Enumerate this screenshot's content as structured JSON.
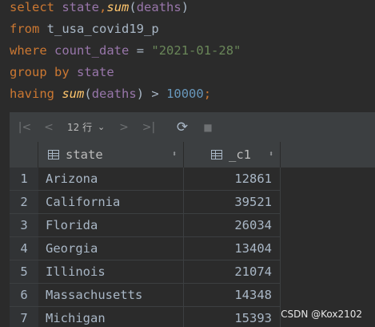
{
  "editor": {
    "line1": {
      "select": "select",
      "col1": "state",
      "comma": ",",
      "fn": "sum",
      "open": "(",
      "col2": "deaths",
      "close": ")"
    },
    "line2": {
      "from": "from",
      "table": "t_usa_covid19_p"
    },
    "line3": {
      "where": "where",
      "col": "count_date",
      "eq": "=",
      "value": "\"2021-01-28\""
    },
    "line4": {
      "group": "group",
      "by": "by",
      "col": "state"
    },
    "line5": {
      "having": "having",
      "fn": "sum",
      "open": "(",
      "col": "deaths",
      "close": ")",
      "gt": ">",
      "value": "10000",
      "semi": ";"
    }
  },
  "toolbar": {
    "first_icon": "|<",
    "prev_icon": "<",
    "row_count": "12 行",
    "dropdown_icon": "⌄",
    "next_icon": ">",
    "last_icon": ">|",
    "refresh_icon": "⟳",
    "stop_icon": "■"
  },
  "grid": {
    "columns": [
      {
        "label": "state",
        "sort_icon": "⬍"
      },
      {
        "label": "_c1",
        "sort_icon": "⬍"
      }
    ],
    "rows": [
      {
        "num": "1",
        "state": "Arizona",
        "c1": "12861"
      },
      {
        "num": "2",
        "state": "California",
        "c1": "39521"
      },
      {
        "num": "3",
        "state": "Florida",
        "c1": "26034"
      },
      {
        "num": "4",
        "state": "Georgia",
        "c1": "13404"
      },
      {
        "num": "5",
        "state": "Illinois",
        "c1": "21074"
      },
      {
        "num": "6",
        "state": "Massachusetts",
        "c1": "14348"
      },
      {
        "num": "7",
        "state": "Michigan",
        "c1": "15393"
      }
    ]
  },
  "watermark": "CSDN @Kox2102"
}
